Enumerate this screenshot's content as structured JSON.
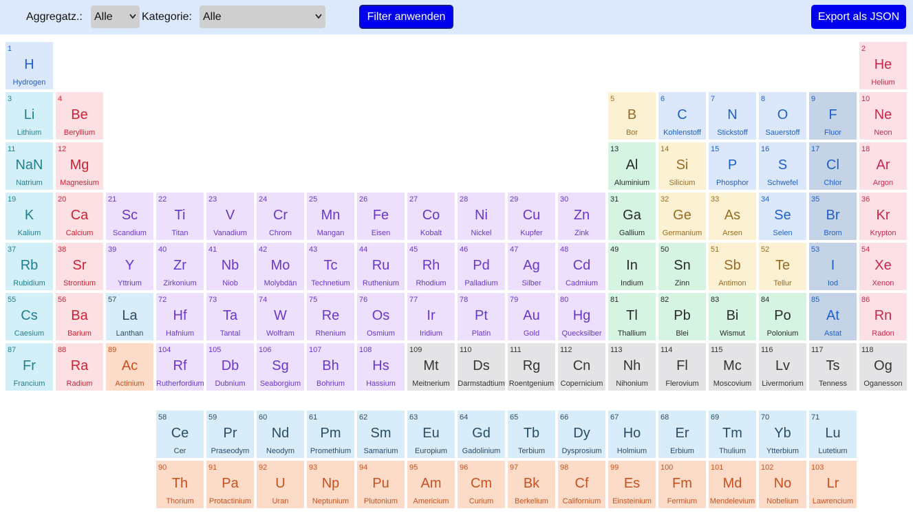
{
  "toolbar": {
    "state_label": "Aggregatz.:",
    "state_value": "Alle",
    "category_label": "Kategorie:",
    "category_value": "Alle",
    "apply_label": "Filter anwenden",
    "export_label": "Export als JSON"
  },
  "category_styles": {
    "nonmetal": {
      "bg": "#dbe8fb",
      "fg": "#1f5fc8"
    },
    "noble": {
      "bg": "#fde0e6",
      "fg": "#c9274a"
    },
    "alkali": {
      "bg": "#d3f0f8",
      "fg": "#1f7f8e"
    },
    "alkaline": {
      "bg": "#fde0e3",
      "fg": "#cc2233"
    },
    "metalloid": {
      "bg": "#fcf1d2",
      "fg": "#9a6a22"
    },
    "halogen": {
      "bg": "#c5d3e6",
      "fg": "#1f5fc8"
    },
    "post": {
      "bg": "#d5f4e2",
      "fg": "#2a2a2a"
    },
    "transition": {
      "bg": "#ece0fd",
      "fg": "#6a37c8"
    },
    "lanthanide": {
      "bg": "#d8ecf9",
      "fg": "#2a4d66"
    },
    "actinide": {
      "bg": "#fcdcc8",
      "fg": "#c8501e"
    },
    "unknown": {
      "bg": "#e4e4e6",
      "fg": "#333333"
    }
  },
  "elements": [
    {
      "n": "1",
      "s": "H",
      "name": "Hydrogen",
      "c": "nonmetal",
      "row": 1,
      "col": 1
    },
    {
      "n": "2",
      "s": "He",
      "name": "Helium",
      "c": "noble",
      "row": 1,
      "col": 18
    },
    {
      "n": "3",
      "s": "Li",
      "name": "Lithium",
      "c": "alkali",
      "row": 2,
      "col": 1
    },
    {
      "n": "4",
      "s": "Be",
      "name": "Beryllium",
      "c": "alkaline",
      "row": 2,
      "col": 2
    },
    {
      "n": "5",
      "s": "B",
      "name": "Bor",
      "c": "metalloid",
      "row": 2,
      "col": 13
    },
    {
      "n": "6",
      "s": "C",
      "name": "Kohlenstoff",
      "c": "nonmetal",
      "row": 2,
      "col": 14
    },
    {
      "n": "7",
      "s": "N",
      "name": "Stickstoff",
      "c": "nonmetal",
      "row": 2,
      "col": 15
    },
    {
      "n": "8",
      "s": "O",
      "name": "Sauerstoff",
      "c": "nonmetal",
      "row": 2,
      "col": 16
    },
    {
      "n": "9",
      "s": "F",
      "name": "Fluor",
      "c": "halogen",
      "row": 2,
      "col": 17
    },
    {
      "n": "10",
      "s": "Ne",
      "name": "Neon",
      "c": "noble",
      "row": 2,
      "col": 18
    },
    {
      "n": "11",
      "s": "NaN",
      "name": "Natrium",
      "c": "alkali",
      "row": 3,
      "col": 1
    },
    {
      "n": "12",
      "s": "Mg",
      "name": "Magnesium",
      "c": "alkaline",
      "row": 3,
      "col": 2
    },
    {
      "n": "13",
      "s": "Al",
      "name": "Aluminium",
      "c": "post",
      "row": 3,
      "col": 13
    },
    {
      "n": "14",
      "s": "Si",
      "name": "Silicium",
      "c": "metalloid",
      "row": 3,
      "col": 14
    },
    {
      "n": "15",
      "s": "P",
      "name": "Phosphor",
      "c": "nonmetal",
      "row": 3,
      "col": 15
    },
    {
      "n": "16",
      "s": "S",
      "name": "Schwefel",
      "c": "nonmetal",
      "row": 3,
      "col": 16
    },
    {
      "n": "17",
      "s": "Cl",
      "name": "Chlor",
      "c": "halogen",
      "row": 3,
      "col": 17
    },
    {
      "n": "18",
      "s": "Ar",
      "name": "Argon",
      "c": "noble",
      "row": 3,
      "col": 18
    },
    {
      "n": "19",
      "s": "K",
      "name": "Kalium",
      "c": "alkali",
      "row": 4,
      "col": 1
    },
    {
      "n": "20",
      "s": "Ca",
      "name": "Calcium",
      "c": "alkaline",
      "row": 4,
      "col": 2
    },
    {
      "n": "21",
      "s": "Sc",
      "name": "Scandium",
      "c": "transition",
      "row": 4,
      "col": 3
    },
    {
      "n": "22",
      "s": "Ti",
      "name": "Titan",
      "c": "transition",
      "row": 4,
      "col": 4
    },
    {
      "n": "23",
      "s": "V",
      "name": "Vanadium",
      "c": "transition",
      "row": 4,
      "col": 5
    },
    {
      "n": "24",
      "s": "Cr",
      "name": "Chrom",
      "c": "transition",
      "row": 4,
      "col": 6
    },
    {
      "n": "25",
      "s": "Mn",
      "name": "Mangan",
      "c": "transition",
      "row": 4,
      "col": 7
    },
    {
      "n": "26",
      "s": "Fe",
      "name": "Eisen",
      "c": "transition",
      "row": 4,
      "col": 8
    },
    {
      "n": "27",
      "s": "Co",
      "name": "Kobalt",
      "c": "transition",
      "row": 4,
      "col": 9
    },
    {
      "n": "28",
      "s": "Ni",
      "name": "Nickel",
      "c": "transition",
      "row": 4,
      "col": 10
    },
    {
      "n": "29",
      "s": "Cu",
      "name": "Kupfer",
      "c": "transition",
      "row": 4,
      "col": 11
    },
    {
      "n": "30",
      "s": "Zn",
      "name": "Zink",
      "c": "transition",
      "row": 4,
      "col": 12
    },
    {
      "n": "31",
      "s": "Ga",
      "name": "Gallium",
      "c": "post",
      "row": 4,
      "col": 13
    },
    {
      "n": "32",
      "s": "Ge",
      "name": "Germanium",
      "c": "metalloid",
      "row": 4,
      "col": 14
    },
    {
      "n": "33",
      "s": "As",
      "name": "Arsen",
      "c": "metalloid",
      "row": 4,
      "col": 15
    },
    {
      "n": "34",
      "s": "Se",
      "name": "Selen",
      "c": "nonmetal",
      "row": 4,
      "col": 16
    },
    {
      "n": "35",
      "s": "Br",
      "name": "Brom",
      "c": "halogen",
      "row": 4,
      "col": 17
    },
    {
      "n": "36",
      "s": "Kr",
      "name": "Krypton",
      "c": "noble",
      "row": 4,
      "col": 18
    },
    {
      "n": "37",
      "s": "Rb",
      "name": "Rubidium",
      "c": "alkali",
      "row": 5,
      "col": 1
    },
    {
      "n": "38",
      "s": "Sr",
      "name": "Strontium",
      "c": "alkaline",
      "row": 5,
      "col": 2
    },
    {
      "n": "39",
      "s": "Y",
      "name": "Yttrium",
      "c": "transition",
      "row": 5,
      "col": 3
    },
    {
      "n": "40",
      "s": "Zr",
      "name": "Zirkonium",
      "c": "transition",
      "row": 5,
      "col": 4
    },
    {
      "n": "41",
      "s": "Nb",
      "name": "Niob",
      "c": "transition",
      "row": 5,
      "col": 5
    },
    {
      "n": "42",
      "s": "Mo",
      "name": "Molybdän",
      "c": "transition",
      "row": 5,
      "col": 6
    },
    {
      "n": "43",
      "s": "Tc",
      "name": "Technetium",
      "c": "transition",
      "row": 5,
      "col": 7
    },
    {
      "n": "44",
      "s": "Ru",
      "name": "Ruthenium",
      "c": "transition",
      "row": 5,
      "col": 8
    },
    {
      "n": "45",
      "s": "Rh",
      "name": "Rhodium",
      "c": "transition",
      "row": 5,
      "col": 9
    },
    {
      "n": "46",
      "s": "Pd",
      "name": "Palladium",
      "c": "transition",
      "row": 5,
      "col": 10
    },
    {
      "n": "47",
      "s": "Ag",
      "name": "Silber",
      "c": "transition",
      "row": 5,
      "col": 11
    },
    {
      "n": "48",
      "s": "Cd",
      "name": "Cadmium",
      "c": "transition",
      "row": 5,
      "col": 12
    },
    {
      "n": "49",
      "s": "In",
      "name": "Indium",
      "c": "post",
      "row": 5,
      "col": 13
    },
    {
      "n": "50",
      "s": "Sn",
      "name": "Zinn",
      "c": "post",
      "row": 5,
      "col": 14
    },
    {
      "n": "51",
      "s": "Sb",
      "name": "Antimon",
      "c": "metalloid",
      "row": 5,
      "col": 15
    },
    {
      "n": "52",
      "s": "Te",
      "name": "Tellur",
      "c": "metalloid",
      "row": 5,
      "col": 16
    },
    {
      "n": "53",
      "s": "I",
      "name": "Iod",
      "c": "halogen",
      "row": 5,
      "col": 17
    },
    {
      "n": "54",
      "s": "Xe",
      "name": "Xenon",
      "c": "noble",
      "row": 5,
      "col": 18
    },
    {
      "n": "55",
      "s": "Cs",
      "name": "Caesium",
      "c": "alkali",
      "row": 6,
      "col": 1
    },
    {
      "n": "56",
      "s": "Ba",
      "name": "Barium",
      "c": "alkaline",
      "row": 6,
      "col": 2
    },
    {
      "n": "57",
      "s": "La",
      "name": "Lanthan",
      "c": "lanthanide",
      "row": 6,
      "col": 3
    },
    {
      "n": "72",
      "s": "Hf",
      "name": "Hafnium",
      "c": "transition",
      "row": 6,
      "col": 4
    },
    {
      "n": "73",
      "s": "Ta",
      "name": "Tantal",
      "c": "transition",
      "row": 6,
      "col": 5
    },
    {
      "n": "74",
      "s": "W",
      "name": "Wolfram",
      "c": "transition",
      "row": 6,
      "col": 6
    },
    {
      "n": "75",
      "s": "Re",
      "name": "Rhenium",
      "c": "transition",
      "row": 6,
      "col": 7
    },
    {
      "n": "76",
      "s": "Os",
      "name": "Osmium",
      "c": "transition",
      "row": 6,
      "col": 8
    },
    {
      "n": "77",
      "s": "Ir",
      "name": "Iridium",
      "c": "transition",
      "row": 6,
      "col": 9
    },
    {
      "n": "78",
      "s": "Pt",
      "name": "Platin",
      "c": "transition",
      "row": 6,
      "col": 10
    },
    {
      "n": "79",
      "s": "Au",
      "name": "Gold",
      "c": "transition",
      "row": 6,
      "col": 11
    },
    {
      "n": "80",
      "s": "Hg",
      "name": "Quecksilber",
      "c": "transition",
      "row": 6,
      "col": 12
    },
    {
      "n": "81",
      "s": "Tl",
      "name": "Thallium",
      "c": "post",
      "row": 6,
      "col": 13
    },
    {
      "n": "82",
      "s": "Pb",
      "name": "Blei",
      "c": "post",
      "row": 6,
      "col": 14
    },
    {
      "n": "83",
      "s": "Bi",
      "name": "Wismut",
      "c": "post",
      "row": 6,
      "col": 15
    },
    {
      "n": "84",
      "s": "Po",
      "name": "Polonium",
      "c": "post",
      "row": 6,
      "col": 16
    },
    {
      "n": "85",
      "s": "At",
      "name": "Astat",
      "c": "halogen",
      "row": 6,
      "col": 17
    },
    {
      "n": "86",
      "s": "Rn",
      "name": "Radon",
      "c": "noble",
      "row": 6,
      "col": 18
    },
    {
      "n": "87",
      "s": "Fr",
      "name": "Francium",
      "c": "alkali",
      "row": 7,
      "col": 1
    },
    {
      "n": "88",
      "s": "Ra",
      "name": "Radium",
      "c": "alkaline",
      "row": 7,
      "col": 2
    },
    {
      "n": "89",
      "s": "Ac",
      "name": "Actinium",
      "c": "actinide",
      "row": 7,
      "col": 3
    },
    {
      "n": "104",
      "s": "Rf",
      "name": "Rutherfordium",
      "c": "transition",
      "row": 7,
      "col": 4
    },
    {
      "n": "105",
      "s": "Db",
      "name": "Dubnium",
      "c": "transition",
      "row": 7,
      "col": 5
    },
    {
      "n": "106",
      "s": "Sg",
      "name": "Seaborgium",
      "c": "transition",
      "row": 7,
      "col": 6
    },
    {
      "n": "107",
      "s": "Bh",
      "name": "Bohrium",
      "c": "transition",
      "row": 7,
      "col": 7
    },
    {
      "n": "108",
      "s": "Hs",
      "name": "Hassium",
      "c": "transition",
      "row": 7,
      "col": 8
    },
    {
      "n": "109",
      "s": "Mt",
      "name": "Meitnerium",
      "c": "unknown",
      "row": 7,
      "col": 9
    },
    {
      "n": "110",
      "s": "Ds",
      "name": "Darmstadtium",
      "c": "unknown",
      "row": 7,
      "col": 10
    },
    {
      "n": "111",
      "s": "Rg",
      "name": "Roentgenium",
      "c": "unknown",
      "row": 7,
      "col": 11
    },
    {
      "n": "112",
      "s": "Cn",
      "name": "Copernicium",
      "c": "unknown",
      "row": 7,
      "col": 12
    },
    {
      "n": "113",
      "s": "Nh",
      "name": "Nihonium",
      "c": "unknown",
      "row": 7,
      "col": 13
    },
    {
      "n": "114",
      "s": "Fl",
      "name": "Flerovium",
      "c": "unknown",
      "row": 7,
      "col": 14
    },
    {
      "n": "115",
      "s": "Mc",
      "name": "Moscovium",
      "c": "unknown",
      "row": 7,
      "col": 15
    },
    {
      "n": "116",
      "s": "Lv",
      "name": "Livermorium",
      "c": "unknown",
      "row": 7,
      "col": 16
    },
    {
      "n": "117",
      "s": "Ts",
      "name": "Tenness",
      "c": "unknown",
      "row": 7,
      "col": 17
    },
    {
      "n": "118",
      "s": "Og",
      "name": "Oganesson",
      "c": "unknown",
      "row": 7,
      "col": 18
    },
    {
      "n": "58",
      "s": "Ce",
      "name": "Cer",
      "c": "lanthanide",
      "row": 9,
      "col": 4
    },
    {
      "n": "59",
      "s": "Pr",
      "name": "Praseodym",
      "c": "lanthanide",
      "row": 9,
      "col": 5
    },
    {
      "n": "60",
      "s": "Nd",
      "name": "Neodym",
      "c": "lanthanide",
      "row": 9,
      "col": 6
    },
    {
      "n": "61",
      "s": "Pm",
      "name": "Promethium",
      "c": "lanthanide",
      "row": 9,
      "col": 7
    },
    {
      "n": "62",
      "s": "Sm",
      "name": "Samarium",
      "c": "lanthanide",
      "row": 9,
      "col": 8
    },
    {
      "n": "63",
      "s": "Eu",
      "name": "Europium",
      "c": "lanthanide",
      "row": 9,
      "col": 9
    },
    {
      "n": "64",
      "s": "Gd",
      "name": "Gadolinium",
      "c": "lanthanide",
      "row": 9,
      "col": 10
    },
    {
      "n": "65",
      "s": "Tb",
      "name": "Terbium",
      "c": "lanthanide",
      "row": 9,
      "col": 11
    },
    {
      "n": "66",
      "s": "Dy",
      "name": "Dysprosium",
      "c": "lanthanide",
      "row": 9,
      "col": 12
    },
    {
      "n": "67",
      "s": "Ho",
      "name": "Holmium",
      "c": "lanthanide",
      "row": 9,
      "col": 13
    },
    {
      "n": "68",
      "s": "Er",
      "name": "Erbium",
      "c": "lanthanide",
      "row": 9,
      "col": 14
    },
    {
      "n": "69",
      "s": "Tm",
      "name": "Thulium",
      "c": "lanthanide",
      "row": 9,
      "col": 15
    },
    {
      "n": "70",
      "s": "Yb",
      "name": "Ytterbium",
      "c": "lanthanide",
      "row": 9,
      "col": 16
    },
    {
      "n": "71",
      "s": "Lu",
      "name": "Lutetium",
      "c": "lanthanide",
      "row": 9,
      "col": 17
    },
    {
      "n": "90",
      "s": "Th",
      "name": "Thorium",
      "c": "actinide",
      "row": 10,
      "col": 4
    },
    {
      "n": "91",
      "s": "Pa",
      "name": "Protactinium",
      "c": "actinide",
      "row": 10,
      "col": 5
    },
    {
      "n": "92",
      "s": "U",
      "name": "Uran",
      "c": "actinide",
      "row": 10,
      "col": 6
    },
    {
      "n": "93",
      "s": "Np",
      "name": "Neptunium",
      "c": "actinide",
      "row": 10,
      "col": 7
    },
    {
      "n": "94",
      "s": "Pu",
      "name": "Plutonium",
      "c": "actinide",
      "row": 10,
      "col": 8
    },
    {
      "n": "95",
      "s": "Am",
      "name": "Americium",
      "c": "actinide",
      "row": 10,
      "col": 9
    },
    {
      "n": "96",
      "s": "Cm",
      "name": "Curium",
      "c": "actinide",
      "row": 10,
      "col": 10
    },
    {
      "n": "97",
      "s": "Bk",
      "name": "Berkelium",
      "c": "actinide",
      "row": 10,
      "col": 11
    },
    {
      "n": "98",
      "s": "Cf",
      "name": "Californium",
      "c": "actinide",
      "row": 10,
      "col": 12
    },
    {
      "n": "99",
      "s": "Es",
      "name": "Einsteinium",
      "c": "actinide",
      "row": 10,
      "col": 13
    },
    {
      "n": "100",
      "s": "Fm",
      "name": "Fermium",
      "c": "actinide",
      "row": 10,
      "col": 14
    },
    {
      "n": "101",
      "s": "Md",
      "name": "Mendelevium",
      "c": "actinide",
      "row": 10,
      "col": 15
    },
    {
      "n": "102",
      "s": "No",
      "name": "Nobelium",
      "c": "actinide",
      "row": 10,
      "col": 16
    },
    {
      "n": "103",
      "s": "Lr",
      "name": "Lawrencium",
      "c": "actinide",
      "row": 10,
      "col": 17
    }
  ]
}
